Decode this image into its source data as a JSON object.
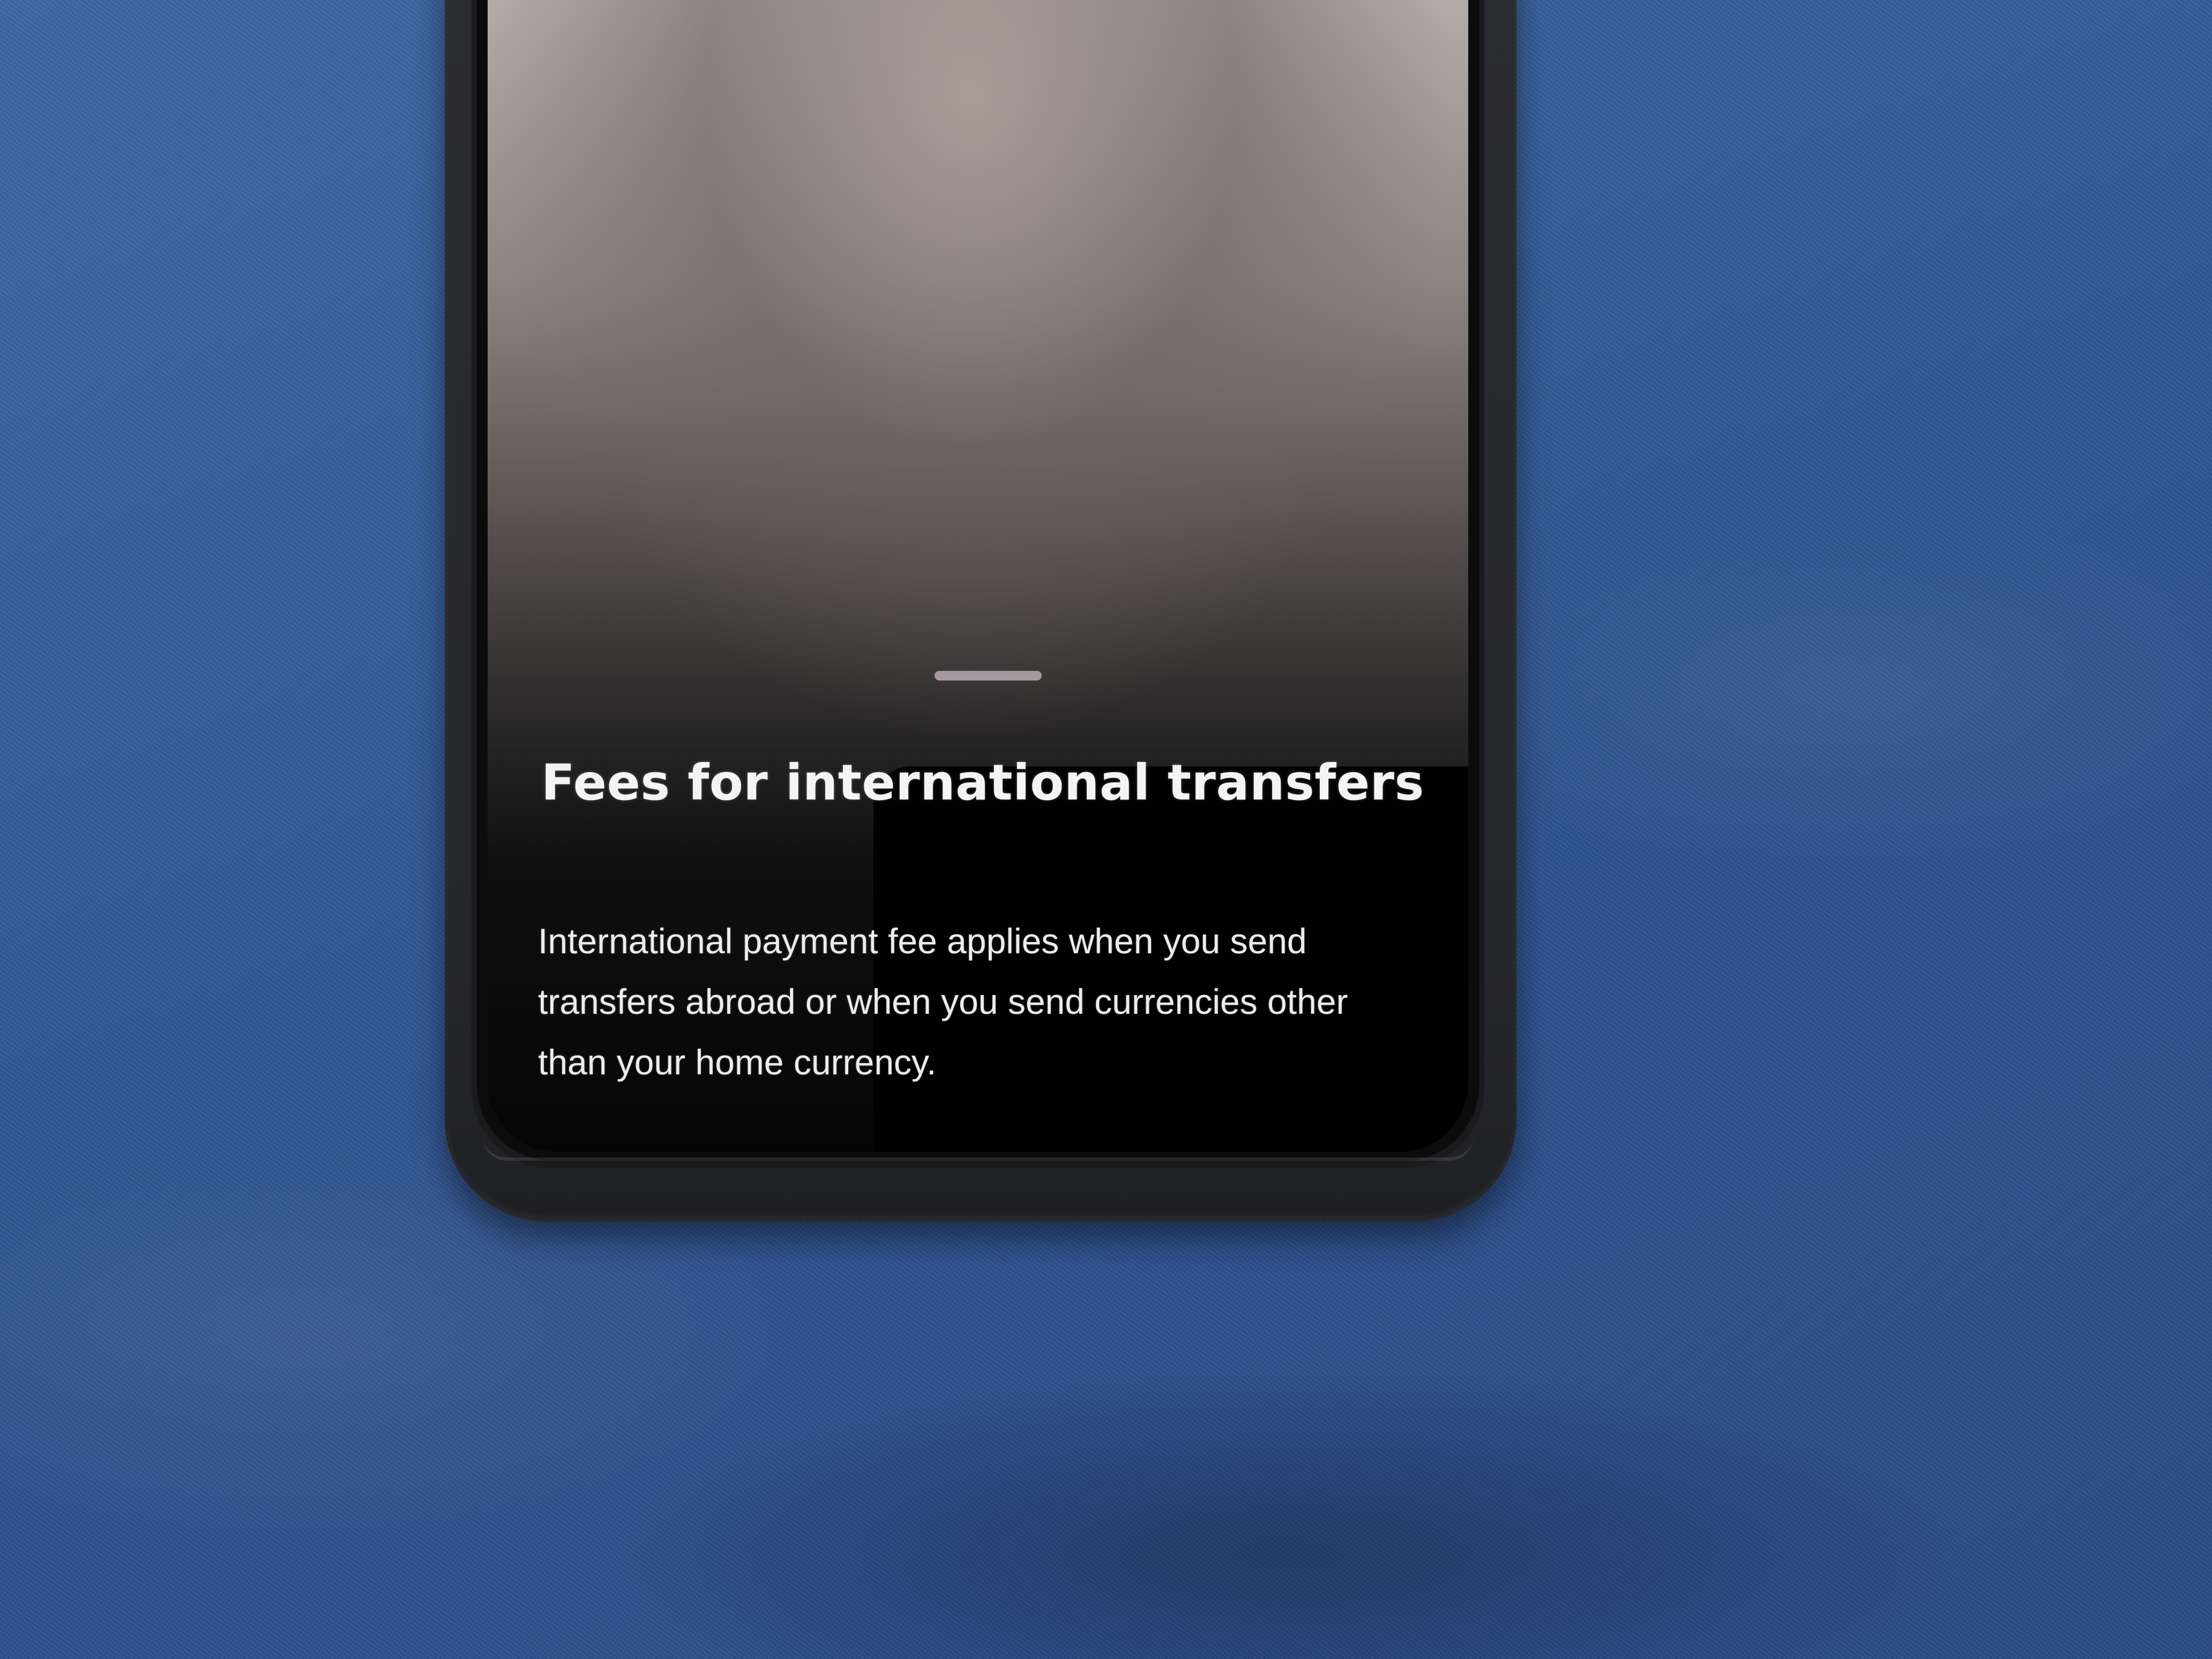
{
  "sheet": {
    "title": "Fees for international transfers",
    "body": "International payment fee applies when you send transfers abroad or when you send currencies other than your home currency."
  },
  "colors": {
    "background_fabric": "#355c99",
    "phone_case": "#26272b",
    "screen_text": "#f4f4f4",
    "drag_handle": "#b8a9b1"
  }
}
